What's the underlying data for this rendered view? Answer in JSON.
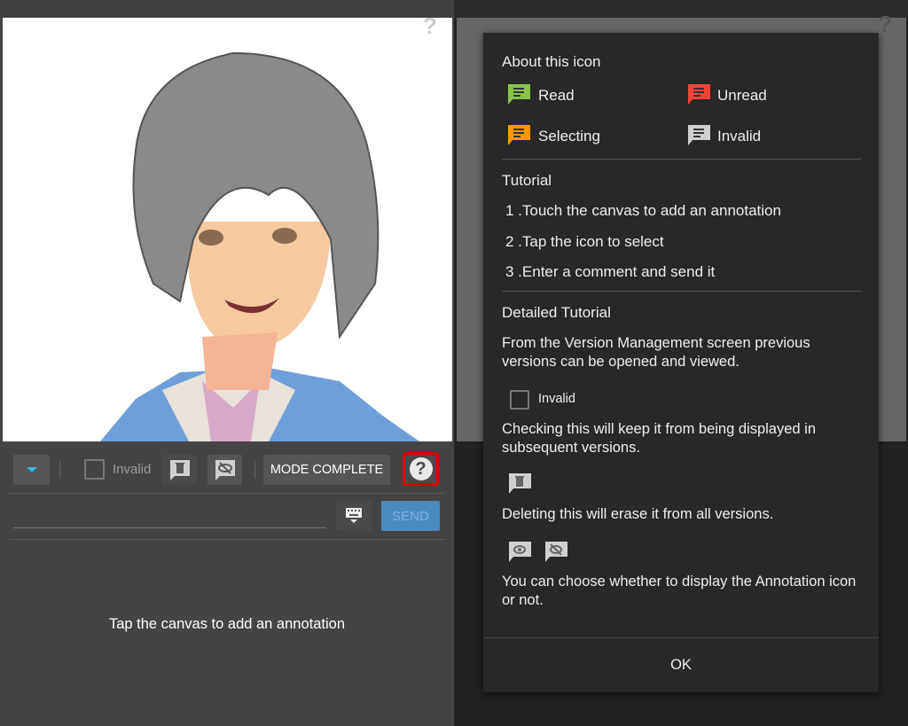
{
  "left": {
    "toolbar": {
      "invalid_label": "Invalid",
      "mode_complete_label": "MODE COMPLETE",
      "help_highlight_color": "#e00000"
    },
    "input": {
      "value": "",
      "placeholder": ""
    },
    "send_label": "SEND",
    "hint": "Tap the canvas to add an annotation"
  },
  "dialog": {
    "about_title": "About this icon",
    "icon_states": [
      {
        "label": "Read",
        "color": "#8bc34a"
      },
      {
        "label": "Unread",
        "color": "#f44336"
      },
      {
        "label": "Selecting",
        "color": "#ff9800"
      },
      {
        "label": "Invalid",
        "color": "#d0d0d0"
      }
    ],
    "tutorial_title": "Tutorial",
    "steps": [
      "1 .Touch the canvas to add an annotation",
      "2 .Tap the icon to select",
      "3 .Enter a comment and send it"
    ],
    "detailed_title": "Detailed Tutorial",
    "versions_text": "From the Version Management screen previous versions can be opened and viewed.",
    "invalid_label": "Invalid",
    "invalid_text": "Checking this will keep it from being displayed in subsequent versions.",
    "delete_text": "Deleting this will erase it from all versions.",
    "display_text": "You can choose whether to display the Annotation icon or not.",
    "ok_label": "OK"
  },
  "icons": [
    "help-icon",
    "dropdown-icon",
    "trash-icon",
    "eye-off-icon",
    "eye-icon",
    "keyboard-icon",
    "comment-icon"
  ]
}
